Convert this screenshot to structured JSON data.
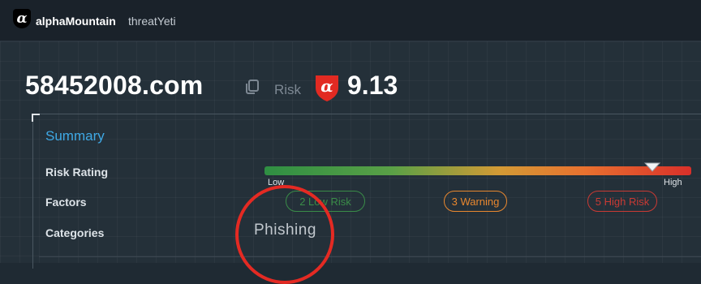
{
  "header": {
    "logo_glyph": "α",
    "brand_name": "alphaMountain",
    "product_name": "threatYeti"
  },
  "domain": {
    "name": "58452008.com",
    "copy_icon": "copy-icon",
    "risk_label": "Risk",
    "risk_logo_glyph": "α",
    "risk_score": "9.13",
    "risk_score_value": 9.13
  },
  "summary": {
    "title": "Summary",
    "rows": {
      "risk_rating": "Risk Rating",
      "factors": "Factors",
      "categories": "Categories"
    },
    "risk_bar": {
      "low_label": "Low",
      "high_label": "High",
      "marker_position_fraction": 0.91
    },
    "factors": {
      "low": "2 Low Risk",
      "warning": "3 Warning",
      "high": "5 High Risk"
    },
    "category": "Phishing"
  },
  "colors": {
    "accent_blue": "#3fa9e6",
    "low_green": "#3a8c48",
    "warning_orange": "#e8872f",
    "high_red": "#c93a34",
    "annotation_red": "#e42a23"
  }
}
